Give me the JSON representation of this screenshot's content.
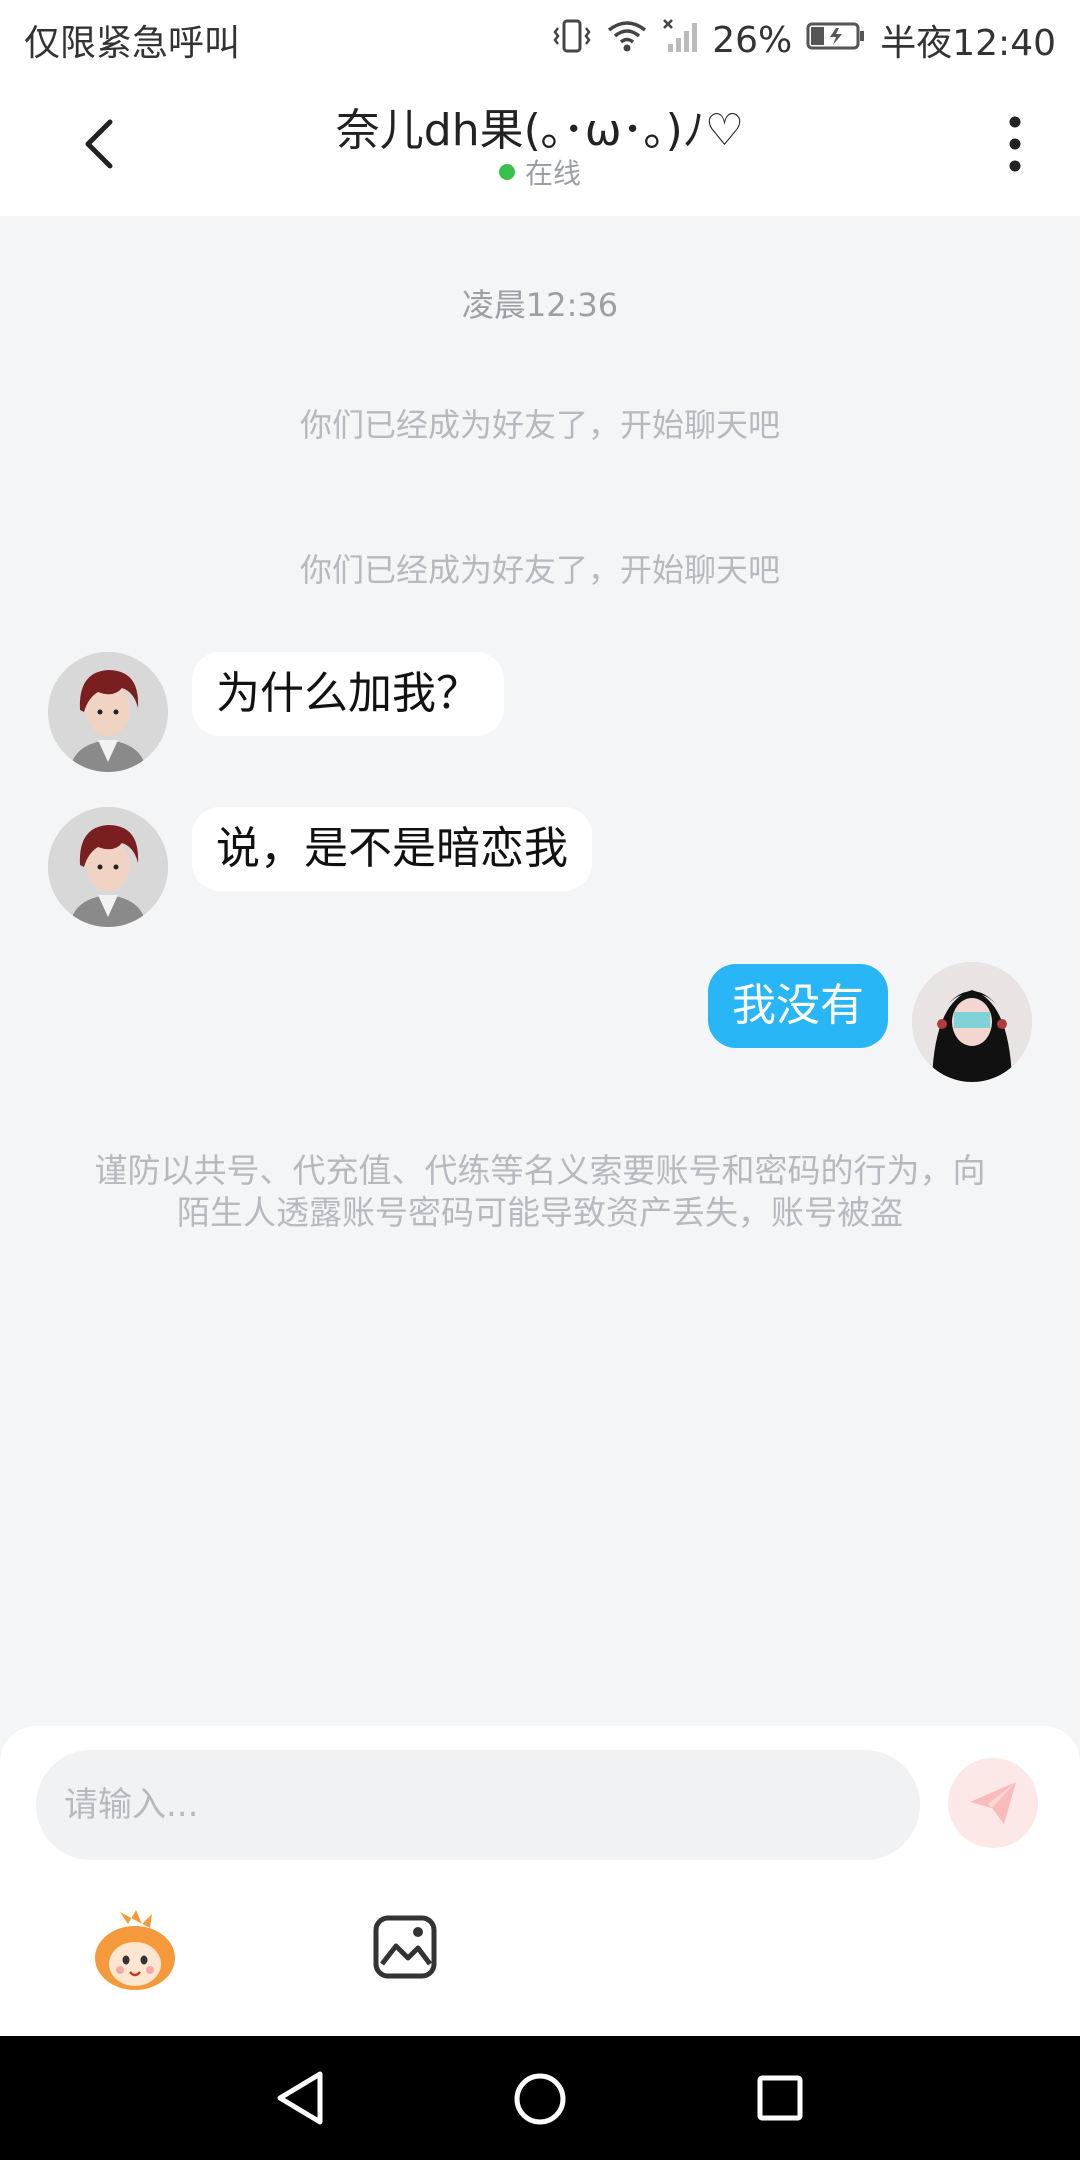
{
  "status_bar": {
    "carrier_text": "仅限紧急呼叫",
    "battery": "26%",
    "time": "半夜12:40",
    "icons": [
      "vibrate-icon",
      "wifi-icon",
      "no-signal-icon",
      "battery-charging-icon"
    ]
  },
  "header": {
    "title": "奈儿dh果(｡･ω･｡)ﾉ♡",
    "presence": "在线",
    "presence_color": "#39c24b",
    "back_icon": "chevron-left-icon",
    "more_icon": "more-vertical-icon"
  },
  "chat": {
    "timestamp": "凌晨12:36",
    "system_messages": [
      "你们已经成为好友了，开始聊天吧",
      "你们已经成为好友了，开始聊天吧"
    ],
    "messages": [
      {
        "sender": "other",
        "text": "为什么加我？"
      },
      {
        "sender": "other",
        "text": "说，是不是暗恋我"
      },
      {
        "sender": "me",
        "text": "我没有"
      }
    ],
    "warning": "谨防以共号、代充值、代练等名义索要账号和密码的行为，向陌生人透露账号密码可能导致资产丢失，账号被盗",
    "bubble_color_mine": "#29b6f6"
  },
  "composer": {
    "placeholder": "请输入...",
    "send_icon": "send-icon",
    "emoji_icon": "emoji-mascot-icon",
    "image_icon": "image-icon"
  },
  "system_nav": {
    "icons": [
      "nav-back-icon",
      "nav-home-icon",
      "nav-recents-icon"
    ]
  }
}
